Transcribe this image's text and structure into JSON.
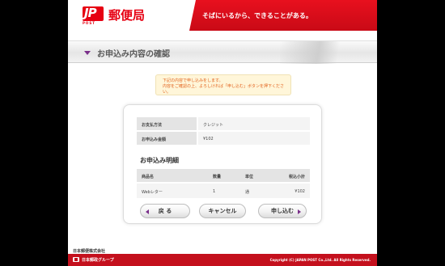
{
  "header": {
    "logo_mark": "JP",
    "logo_post": "POST",
    "logo_name": "郵便局",
    "tagline": "そばにいるから、できることがある。"
  },
  "titlebar": {
    "title": "お申込み内容の確認"
  },
  "notice": {
    "line1": "下記の内容で申し込みをします。",
    "line2": "内容をご確認の上、よろしければ「申し込む」ボタンを押下ください。"
  },
  "summary": {
    "rows": [
      {
        "label": "お支払方法",
        "value": "クレジット"
      },
      {
        "label": "お申込み金額",
        "value": "¥102"
      }
    ]
  },
  "details": {
    "title": "お申込み明細",
    "columns": [
      "商品名",
      "数量",
      "単位",
      "税込小計"
    ],
    "rows": [
      {
        "name": "Webレター",
        "qty": "1",
        "unit": "通",
        "subtotal": "¥102"
      }
    ]
  },
  "buttons": {
    "back": "戻 る",
    "cancel": "キャンセル",
    "submit": "申し込む"
  },
  "footer": {
    "company": "日本郵便株式会社",
    "group": "日本郵政グループ",
    "copyright": "Copyright (C) JAPAN POST Co.,Ltd.  All Rights Reserved."
  },
  "colors": {
    "brand_red": "#e60012",
    "accent_purple": "#7a2f8a",
    "notice_text": "#e2611b"
  }
}
